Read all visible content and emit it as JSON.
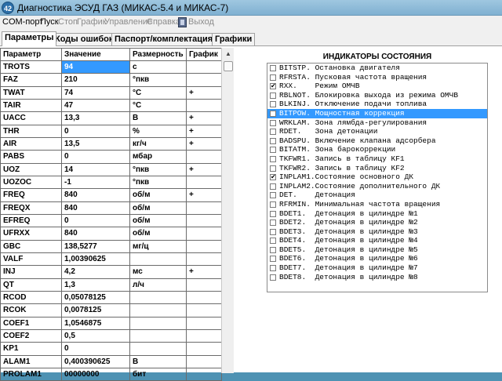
{
  "window": {
    "icon_text": "42",
    "title": "Диагностика ЭСУД ГАЗ (МИКАС-5.4 и МИКАС-7)"
  },
  "menu": {
    "items": [
      "COM-порт",
      "Пуск",
      "Стоп",
      "График",
      "Управление",
      "Справка"
    ],
    "exit_label": "Выход"
  },
  "tabs": [
    "Параметры",
    "Коды ошибок",
    "Паспорт/комплектация",
    "Графики"
  ],
  "table": {
    "headers": [
      "Параметр",
      "Значение",
      "Размерность",
      "График"
    ],
    "rows": [
      [
        "TROTS",
        "94",
        "с",
        ""
      ],
      [
        "FAZ",
        "210",
        "°пкв",
        ""
      ],
      [
        "TWAT",
        "74",
        "°C",
        "+"
      ],
      [
        "TAIR",
        "47",
        "°C",
        ""
      ],
      [
        "UACC",
        "13,3",
        "В",
        "+"
      ],
      [
        "THR",
        "0",
        "%",
        "+"
      ],
      [
        "AIR",
        "13,5",
        "кг/ч",
        "+"
      ],
      [
        "PABS",
        "0",
        "мбар",
        ""
      ],
      [
        "UOZ",
        "14",
        "°пкв",
        "+"
      ],
      [
        "UOZOC",
        "-1",
        "°пкв",
        ""
      ],
      [
        "FREQ",
        "840",
        "об/м",
        "+"
      ],
      [
        "FREQX",
        "840",
        "об/м",
        ""
      ],
      [
        "EFREQ",
        "0",
        "об/м",
        ""
      ],
      [
        "UFRXX",
        "840",
        "об/м",
        ""
      ],
      [
        "GBC",
        "138,5277",
        "мг/ц",
        ""
      ],
      [
        "VALF",
        "1,00390625",
        "",
        ""
      ],
      [
        "INJ",
        "4,2",
        "мс",
        "+"
      ],
      [
        "QT",
        "1,3",
        "л/ч",
        ""
      ],
      [
        "RCOD",
        "0,05078125",
        "",
        ""
      ],
      [
        "RCOK",
        "0,0078125",
        "",
        ""
      ],
      [
        "COEF1",
        "1,0546875",
        "",
        ""
      ],
      [
        "COEF2",
        "0,5",
        "",
        ""
      ],
      [
        "KP1",
        "0",
        "",
        ""
      ],
      [
        "ALAM1",
        "0,400390625",
        "В",
        ""
      ],
      [
        "PROLAM1",
        "00000000",
        "бит",
        ""
      ]
    ]
  },
  "indicators": {
    "title": "ИНДИКАТОРЫ СОСТОЯНИЯ",
    "items": [
      {
        "text": "BITSTP. Остановка двигателя",
        "checked": false
      },
      {
        "text": "RFRSTA. Пусковая частота вращения",
        "checked": false
      },
      {
        "text": "RXX.    Режим ОМЧВ",
        "checked": true
      },
      {
        "text": "RBLNOT. Блокировка выхода из режима ОМЧВ",
        "checked": false
      },
      {
        "text": "BLKINJ. Отключение подачи топлива",
        "checked": false
      },
      {
        "text": "BITPOW. Мощностная коррекция",
        "checked": false
      },
      {
        "text": "WRKLAM. Зона лямбда-регулирования",
        "checked": false
      },
      {
        "text": "RDET.   Зона детонации",
        "checked": false
      },
      {
        "text": "BADSPU. Включение клапана адсорбера",
        "checked": false
      },
      {
        "text": "BITATM. Зона барокоррекции",
        "checked": false
      },
      {
        "text": "TKFWR1. Запись в таблицу KF1",
        "checked": false
      },
      {
        "text": "TKFWR2. Запись в таблицу KF2",
        "checked": false
      },
      {
        "text": "INPLAM1.Состояние основного ДК",
        "checked": true
      },
      {
        "text": "INPLAM2.Состояние дополнительного ДК",
        "checked": false
      },
      {
        "text": "DET.    Детонация",
        "checked": false
      },
      {
        "text": "RFRMIN. Минимальная частота вращения",
        "checked": false
      },
      {
        "text": "BDET1.  Детонация в цилиндре №1",
        "checked": false
      },
      {
        "text": "BDET2.  Детонация в цилиндре №2",
        "checked": false
      },
      {
        "text": "BDET3.  Детонация в цилиндре №3",
        "checked": false
      },
      {
        "text": "BDET4.  Детонация в цилиндре №4",
        "checked": false
      },
      {
        "text": "BDET5.  Детонация в цилиндре №5",
        "checked": false
      },
      {
        "text": "BDET6.  Детонация в цилиндре №6",
        "checked": false
      },
      {
        "text": "BDET7.  Детонация в цилиндре №7",
        "checked": false
      },
      {
        "text": "BDET8.  Детонация в цилиндре №8",
        "checked": false
      }
    ]
  }
}
